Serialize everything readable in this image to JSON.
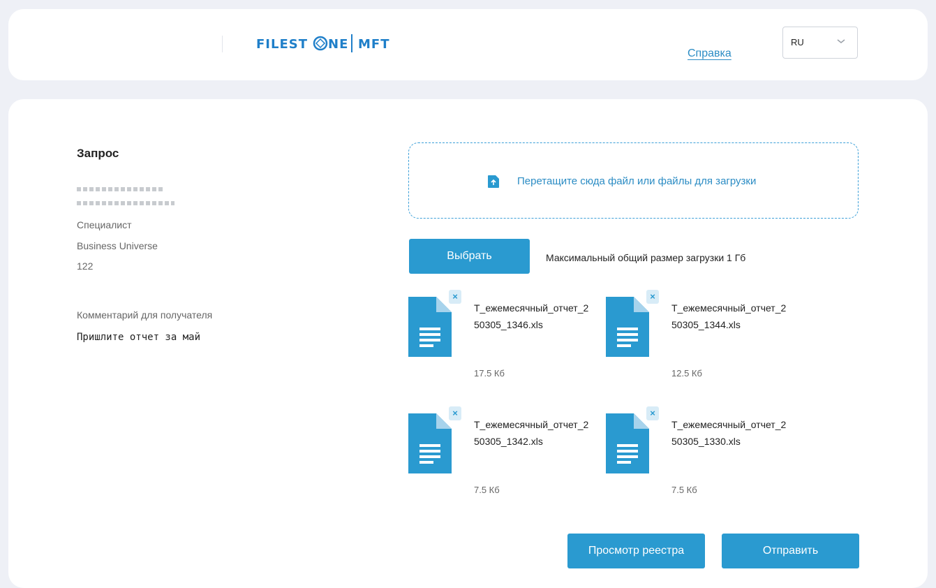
{
  "header": {
    "logo": "FILESTONE | MFT",
    "help_link": "Справка",
    "language": "RU"
  },
  "request": {
    "title": "Запрос",
    "role": "Специалист",
    "company": "Business Universe",
    "number": "122",
    "comment_label": "Комментарий для получателя",
    "comment_text": "Пришлите отчет за май"
  },
  "upload": {
    "dropzone_text": "Перетащите сюда файл или файлы для загрузки",
    "choose_button": "Выбрать",
    "max_size_text": "Максимальный общий размер загрузки 1 Гб"
  },
  "files": [
    {
      "name": "T_ежемесячный_отчет_250305_1346.xls",
      "size": "17.5 Кб"
    },
    {
      "name": "T_ежемесячный_отчет_250305_1344.xls",
      "size": "12.5 Кб"
    },
    {
      "name": "T_ежемесячный_отчет_250305_1342.xls",
      "size": "7.5 Кб"
    },
    {
      "name": "T_ежемесячный_отчет_250305_1330.xls",
      "size": "7.5 Кб"
    }
  ],
  "actions": {
    "registry_button": "Просмотр реестра",
    "send_button": "Отправить"
  },
  "colors": {
    "accent": "#2a9ad0",
    "link": "#2b8cc4",
    "background": "#eef0f6"
  },
  "icons": {
    "upload": "file-upload-icon",
    "document": "document-icon",
    "remove": "close-icon",
    "dropdown": "chevron-down-icon"
  }
}
